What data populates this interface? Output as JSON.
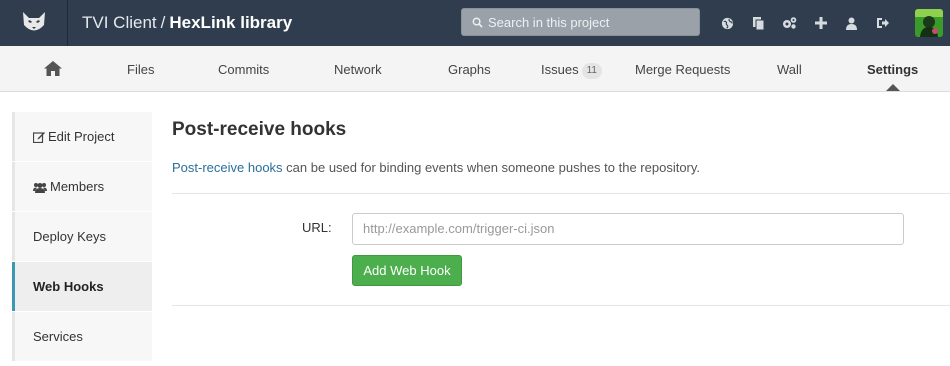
{
  "header": {
    "group": "TVI Client",
    "separator": "/",
    "project": "HexLink library",
    "search_placeholder": "Search in this project",
    "icons": [
      "globe-icon",
      "copy-icon",
      "settings-gears-icon",
      "plus-icon",
      "user-icon",
      "sign-out-icon"
    ]
  },
  "nav": {
    "home_icon": "home-icon",
    "items": [
      {
        "label": "Files"
      },
      {
        "label": "Commits"
      },
      {
        "label": "Network"
      },
      {
        "label": "Graphs"
      },
      {
        "label": "Issues",
        "badge": "11"
      },
      {
        "label": "Merge Requests"
      },
      {
        "label": "Wall"
      },
      {
        "label": "Settings",
        "active": true
      }
    ]
  },
  "sidebar": {
    "items": [
      {
        "label": "Edit Project",
        "icon": "edit-icon"
      },
      {
        "label": "Members",
        "icon": "users-icon"
      },
      {
        "label": "Deploy Keys"
      },
      {
        "label": "Web Hooks",
        "active": true
      },
      {
        "label": "Services"
      }
    ]
  },
  "main": {
    "title": "Post-receive hooks",
    "desc_link": "Post-receive hooks",
    "desc_text": " can be used for binding events when someone pushes to the repository.",
    "url_label": "URL:",
    "url_placeholder": "http://example.com/trigger-ci.json",
    "add_button": "Add Web Hook"
  },
  "colors": {
    "header_bg": "#2f3d4e",
    "link": "#2a6f9b",
    "button_green": "#4cae4c",
    "active_sidebar_accent": "#3b9ab2"
  }
}
